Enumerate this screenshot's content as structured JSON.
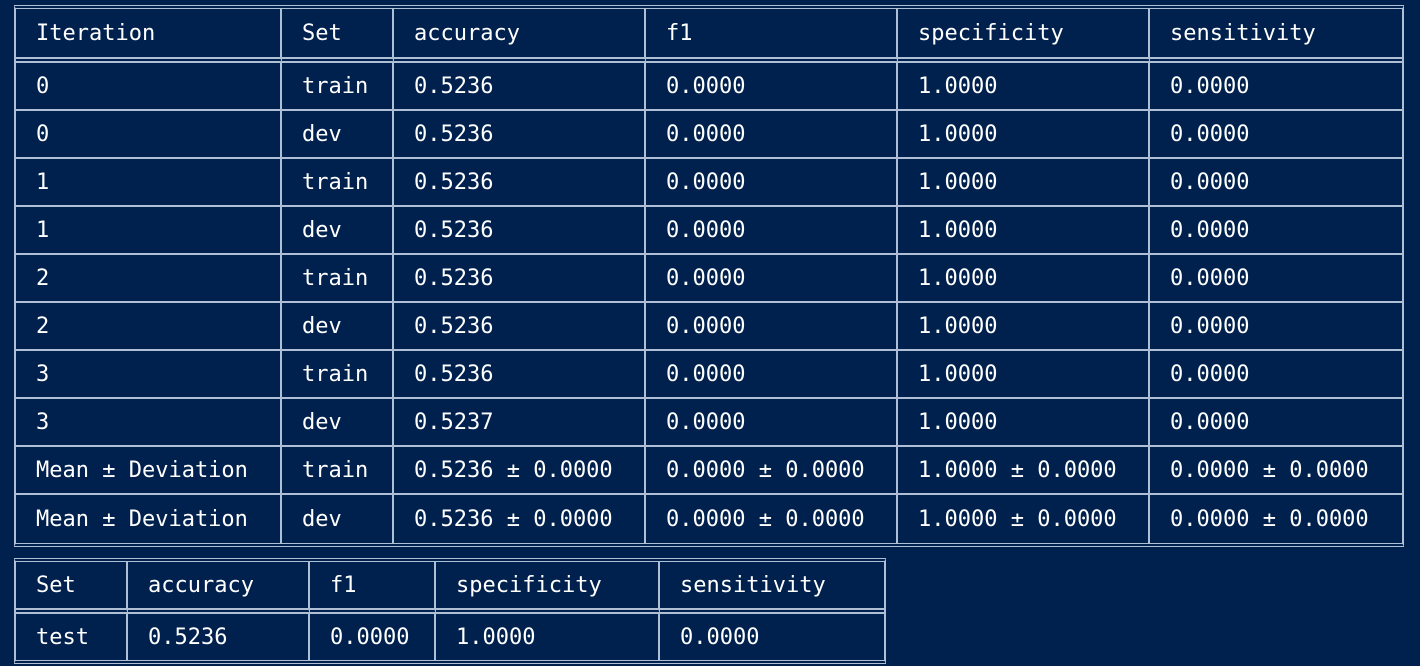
{
  "results_table": {
    "headers": [
      "Iteration",
      "Set",
      "accuracy",
      "f1",
      "specificity",
      "sensitivity"
    ],
    "rows": [
      [
        "0",
        "train",
        "0.5236",
        "0.0000",
        "1.0000",
        "0.0000"
      ],
      [
        "0",
        "dev",
        "0.5236",
        "0.0000",
        "1.0000",
        "0.0000"
      ],
      [
        "1",
        "train",
        "0.5236",
        "0.0000",
        "1.0000",
        "0.0000"
      ],
      [
        "1",
        "dev",
        "0.5236",
        "0.0000",
        "1.0000",
        "0.0000"
      ],
      [
        "2",
        "train",
        "0.5236",
        "0.0000",
        "1.0000",
        "0.0000"
      ],
      [
        "2",
        "dev",
        "0.5236",
        "0.0000",
        "1.0000",
        "0.0000"
      ],
      [
        "3",
        "train",
        "0.5236",
        "0.0000",
        "1.0000",
        "0.0000"
      ],
      [
        "3",
        "dev",
        "0.5237",
        "0.0000",
        "1.0000",
        "0.0000"
      ],
      [
        "Mean ± Deviation",
        "train",
        "0.5236 ± 0.0000",
        "0.0000 ± 0.0000",
        "1.0000 ± 0.0000",
        "0.0000 ± 0.0000"
      ],
      [
        "Mean ± Deviation",
        "dev",
        "0.5236 ± 0.0000",
        "0.0000 ± 0.0000",
        "1.0000 ± 0.0000",
        "0.0000 ± 0.0000"
      ]
    ]
  },
  "test_table": {
    "headers": [
      "Set",
      "accuracy",
      "f1",
      "specificity",
      "sensitivity"
    ],
    "rows": [
      [
        "test",
        "0.5236",
        "0.0000",
        "1.0000",
        "0.0000"
      ]
    ]
  },
  "colors": {
    "background": "#00214d",
    "border": "#aebfd6",
    "text": "#ffffff"
  }
}
